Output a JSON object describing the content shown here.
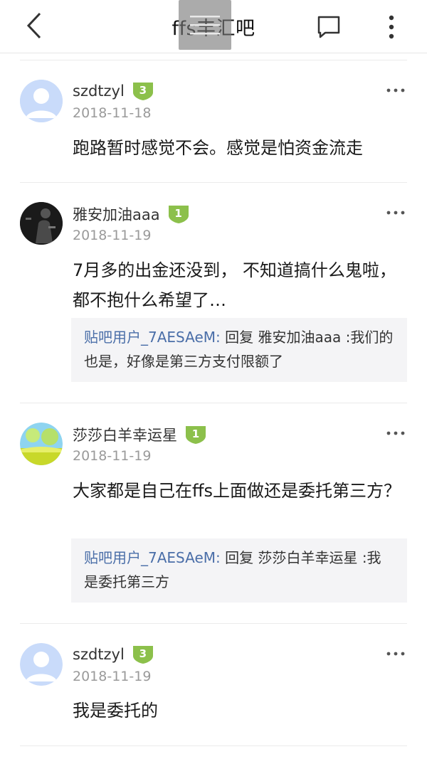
{
  "nav": {
    "title": "ffs丰汇吧"
  },
  "posts": [
    {
      "username": "szdtzyl",
      "level": "3",
      "date": "2018-11-18",
      "body": "跑路暂时感觉不会。感觉是怕资金流走"
    },
    {
      "username": "雅安加油aaa",
      "level": "1",
      "date": "2018-11-19",
      "body": "7月多的出金还没到， 不知道搞什么鬼啦， 都不抱什么希望了…",
      "reply": {
        "author": "贴吧用户_7AESAeM:",
        "text": " 回复 雅安加油aaa :我们的也是，好像是第三方支付限额了"
      }
    },
    {
      "username": "莎莎白羊幸运星",
      "level": "1",
      "date": "2018-11-19",
      "body": "大家都是自己在ffs上面做还是委托第三方？",
      "reply": {
        "author": "贴吧用户_7AESAeM:",
        "text": " 回复 莎莎白羊幸运星 :我是委托第三方"
      }
    },
    {
      "username": "szdtzyl",
      "level": "3",
      "date": "2018-11-19",
      "body": "我是委托的"
    }
  ],
  "colors": {
    "level_badge": "#8cc04b",
    "reply_author": "#4a6ea8",
    "date": "#9a9a9a",
    "reply_bg": "#f4f4f6"
  },
  "icons": {
    "back": "chevron-left-icon",
    "menu": "hamburger-menu-icon",
    "comment": "comment-bubble-icon",
    "more": "vertical-dots-icon",
    "post_more": "horizontal-dots-icon"
  }
}
